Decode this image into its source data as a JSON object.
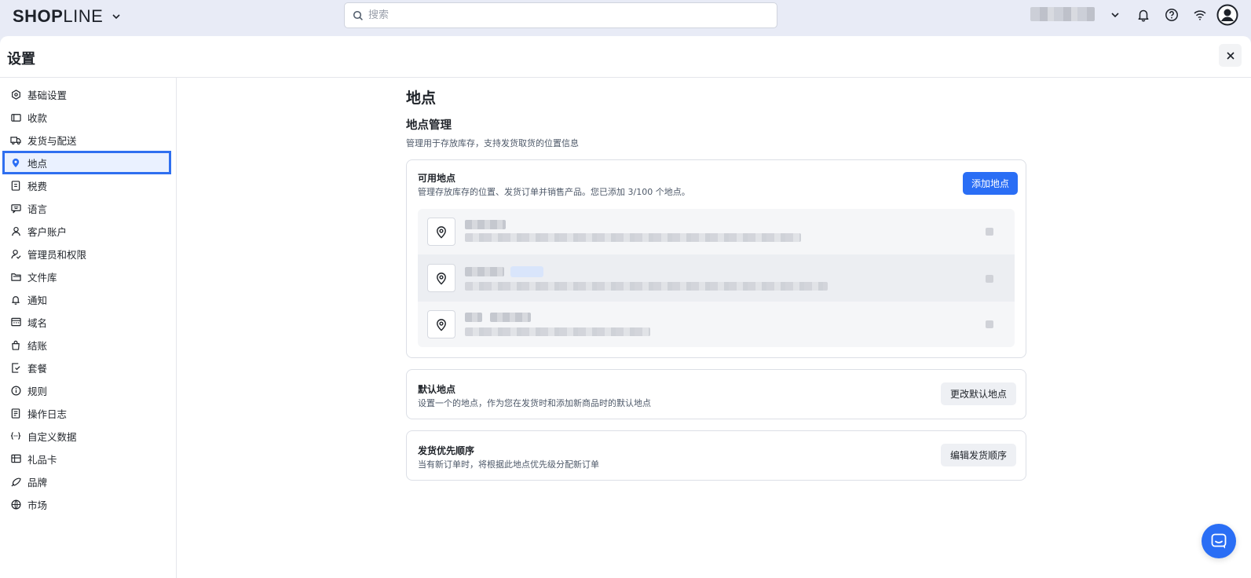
{
  "header": {
    "logo_bold": "SHOP",
    "logo_light": "LINE",
    "search_placeholder": "搜索"
  },
  "panel": {
    "title": "设置"
  },
  "sidebar": {
    "items": [
      {
        "label": "基础设置",
        "icon": "settings-hexagon-icon"
      },
      {
        "label": "收款",
        "icon": "wallet-icon"
      },
      {
        "label": "发货与配送",
        "icon": "truck-icon"
      },
      {
        "label": "地点",
        "icon": "location-pin-icon",
        "active": true
      },
      {
        "label": "税费",
        "icon": "tax-receipt-icon"
      },
      {
        "label": "语言",
        "icon": "language-icon"
      },
      {
        "label": "客户账户",
        "icon": "user-icon"
      },
      {
        "label": "管理员和权限",
        "icon": "user-permission-icon"
      },
      {
        "label": "文件库",
        "icon": "folder-icon"
      },
      {
        "label": "通知",
        "icon": "bell-icon"
      },
      {
        "label": "域名",
        "icon": "domain-icon"
      },
      {
        "label": "结账",
        "icon": "shopping-bag-icon"
      },
      {
        "label": "套餐",
        "icon": "plan-icon"
      },
      {
        "label": "规则",
        "icon": "info-icon"
      },
      {
        "label": "操作日志",
        "icon": "log-icon"
      },
      {
        "label": "自定义数据",
        "icon": "code-brackets-icon"
      },
      {
        "label": "礼品卡",
        "icon": "gift-card-icon"
      },
      {
        "label": "品牌",
        "icon": "brand-icon"
      },
      {
        "label": "市场",
        "icon": "globe-icon"
      }
    ]
  },
  "content": {
    "page_title": "地点",
    "section_title": "地点管理",
    "section_desc": "管理用于存放库存，支持发货取货的位置信息",
    "available": {
      "title": "可用地点",
      "desc": "管理存放库存的位置、发货订单并销售产品。您已添加 3/100 个地点。",
      "add_button": "添加地点"
    },
    "default": {
      "title": "默认地点",
      "desc": "设置一个的地点，作为您在发货时和添加新商品时的默认地点",
      "button": "更改默认地点"
    },
    "priority": {
      "title": "发货优先顺序",
      "desc": "当有新订单时，将根据此地点优先级分配新订单",
      "button": "编辑发货顺序"
    }
  },
  "colors": {
    "accent": "#2a6ef5",
    "active_outline": "#2f6ff0"
  }
}
